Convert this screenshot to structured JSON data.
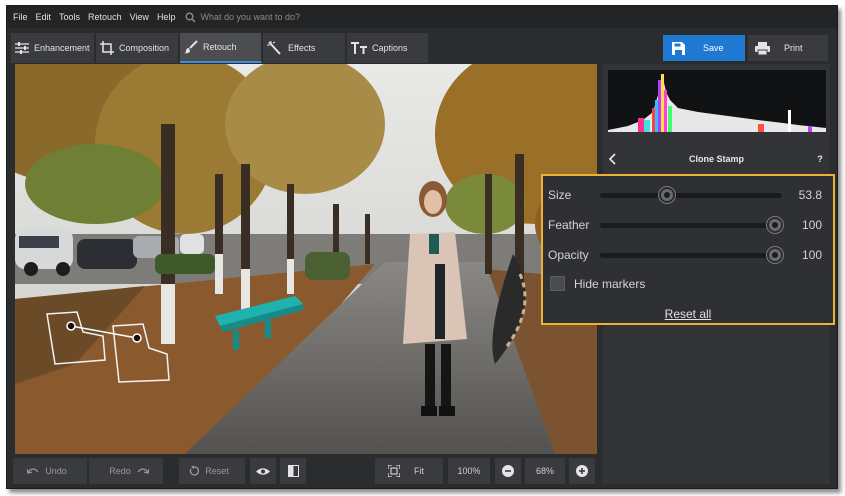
{
  "menu": {
    "items": [
      "File",
      "Edit",
      "Tools",
      "Retouch",
      "View",
      "Help"
    ],
    "search_placeholder": "What do you want to do?"
  },
  "tabs": [
    {
      "label": "Enhancement",
      "icon": "sliders-icon"
    },
    {
      "label": "Composition",
      "icon": "crop-icon"
    },
    {
      "label": "Retouch",
      "icon": "brush-icon",
      "active": true
    },
    {
      "label": "Effects",
      "icon": "magic-wand-icon"
    },
    {
      "label": "Captions",
      "icon": "text-icon"
    }
  ],
  "actions": {
    "save_label": "Save",
    "print_label": "Print",
    "accent_color": "#1f78d1"
  },
  "bottom_bar": {
    "undo": "Undo",
    "redo": "Redo",
    "reset": "Reset",
    "fit": "Fit",
    "zoom_100": "100%",
    "zoom_level": "68%"
  },
  "panel": {
    "tool_title": "Clone Stamp",
    "help": "?",
    "sliders": [
      {
        "label": "Size",
        "value": "53.8",
        "fraction": 0.37
      },
      {
        "label": "Feather",
        "value": "100",
        "fraction": 0.96
      },
      {
        "label": "Opacity",
        "value": "100",
        "fraction": 0.96
      }
    ],
    "hide_markers": {
      "label": "Hide markers",
      "checked": false
    },
    "reset_all": "Reset all",
    "highlight_color": "#f0b033"
  }
}
